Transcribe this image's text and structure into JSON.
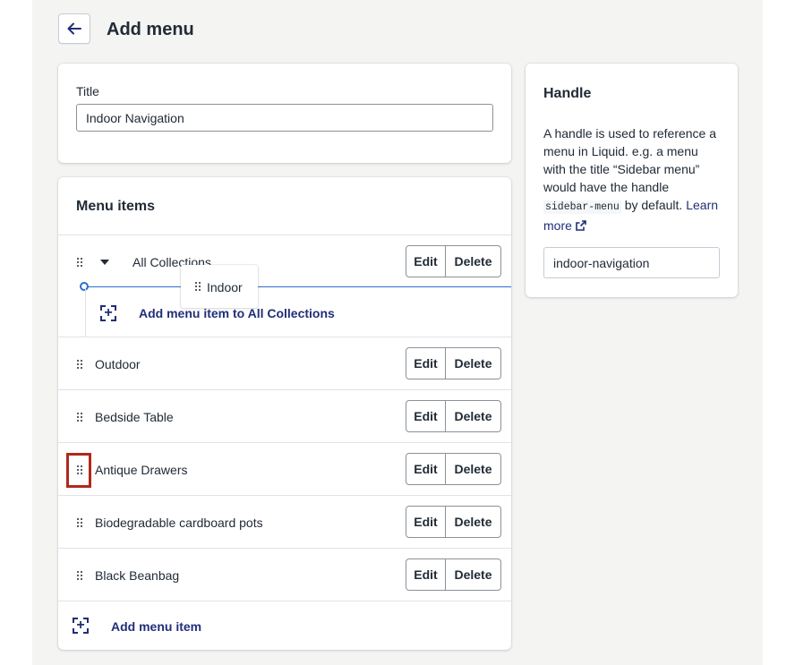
{
  "header": {
    "back_label": "←",
    "title": "Add menu"
  },
  "title_card": {
    "label": "Title",
    "value": "Indoor Navigation"
  },
  "menu_items_card": {
    "title": "Menu items",
    "edit_label": "Edit",
    "delete_label": "Delete",
    "parent_item": {
      "label": "All Collections"
    },
    "dragging_item": {
      "label": "Indoor"
    },
    "add_child_label": "Add menu item to All Collections",
    "items": [
      {
        "label": "Outdoor"
      },
      {
        "label": "Bedside Table"
      },
      {
        "label": "Antique Drawers"
      },
      {
        "label": "Biodegradable cardboard pots"
      },
      {
        "label": "Black Beanbag"
      }
    ],
    "add_item_label": "Add menu item"
  },
  "handle_card": {
    "title": "Handle",
    "help_text_1": "A handle is used to reference a menu in Liquid. e.g. a menu with the title “Sidebar menu” would have the handle",
    "help_code": "sidebar-menu",
    "help_text_2": " by default.",
    "learn_more": "Learn more",
    "value": "indoor-navigation"
  },
  "colors": {
    "link": "#202e78",
    "highlight": "#b0291c",
    "drop_indicator": "#2c6ecb"
  }
}
